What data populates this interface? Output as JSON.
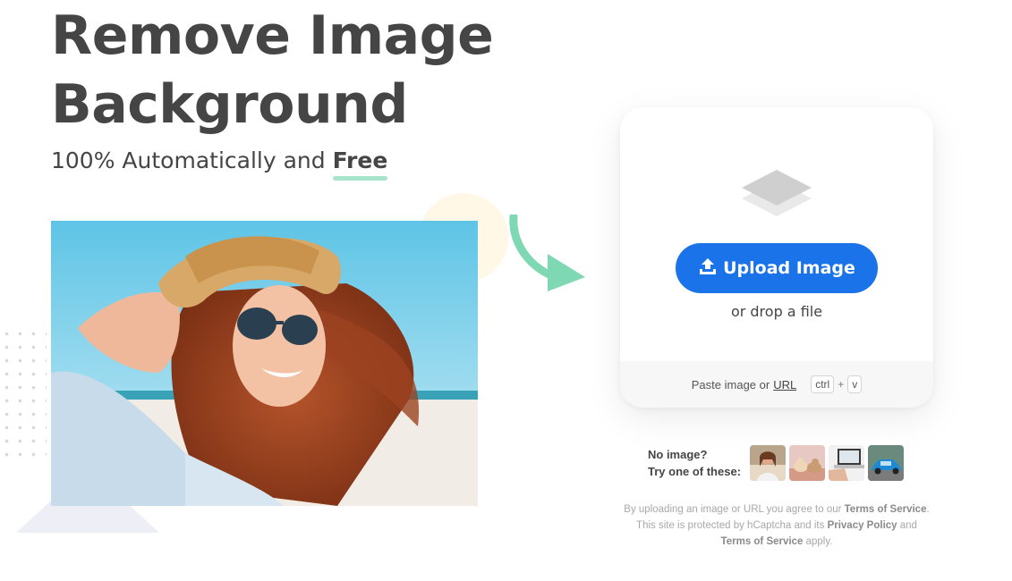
{
  "hero": {
    "title_line1": "Remove Image",
    "title_line2": "Background",
    "subtitle_prefix": "100% Automatically and",
    "subtitle_emphasis": "Free"
  },
  "upload": {
    "button_label": "Upload Image",
    "drop_text": "or drop a file",
    "paste_prefix": "Paste image or",
    "paste_url": "URL",
    "key_ctrl": "ctrl",
    "key_plus": "+",
    "key_v": "v"
  },
  "samples": {
    "line1": "No image?",
    "line2": "Try one of these:",
    "thumbnails": [
      "woman",
      "animals",
      "laptop",
      "car"
    ]
  },
  "legal": {
    "l1_prefix": "By uploading an image or URL you agree to our",
    "terms": "Terms of Service",
    "l1_suffix": ".",
    "l2_prefix": "This site is protected by hCaptcha and its",
    "privacy": "Privacy Policy",
    "l2_suffix": "and",
    "terms2": "Terms of Service",
    "l3_suffix": "apply."
  },
  "colors": {
    "primary": "#1a73e8",
    "heading": "#454545",
    "accent_underline": "#a8e4cc",
    "arrow": "#7fd8b4"
  },
  "icons": {
    "upload": "upload-icon",
    "layers": "layers-icon",
    "arrow": "curved-arrow-icon"
  }
}
